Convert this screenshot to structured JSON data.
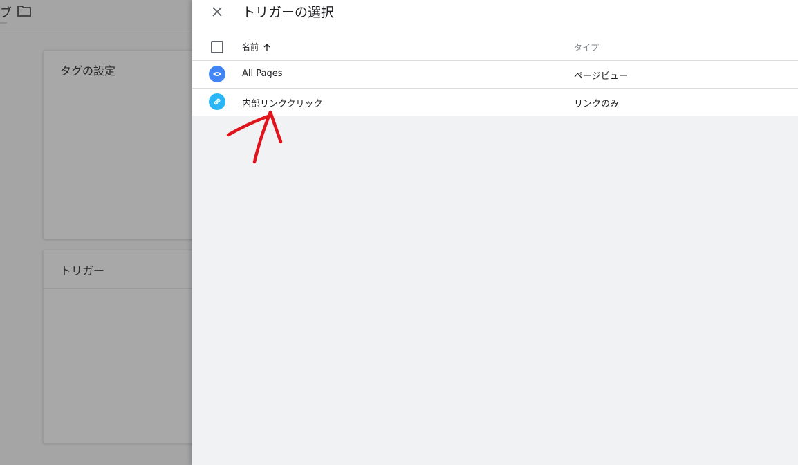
{
  "background": {
    "tab_fragment": "ブ",
    "folder_icon": "folder-icon",
    "card_tag_title": "タグの設定",
    "card_trigger_title": "トリガー"
  },
  "panel": {
    "title": "トリガーの選択",
    "close_icon": "close-icon",
    "columns": {
      "name": "名前",
      "type": "タイプ",
      "sort_icon": "arrow-up-icon"
    },
    "rows": [
      {
        "name": "All Pages",
        "type": "ページビュー",
        "icon": "eye-icon",
        "icon_color": "#4285f4"
      },
      {
        "name": "内部リンククリック",
        "type": "リンクのみ",
        "icon": "link-icon",
        "icon_color": "#29b6f6"
      }
    ]
  },
  "annotation": {
    "color": "#e0141c",
    "icon": "red-arrow-annotation"
  }
}
